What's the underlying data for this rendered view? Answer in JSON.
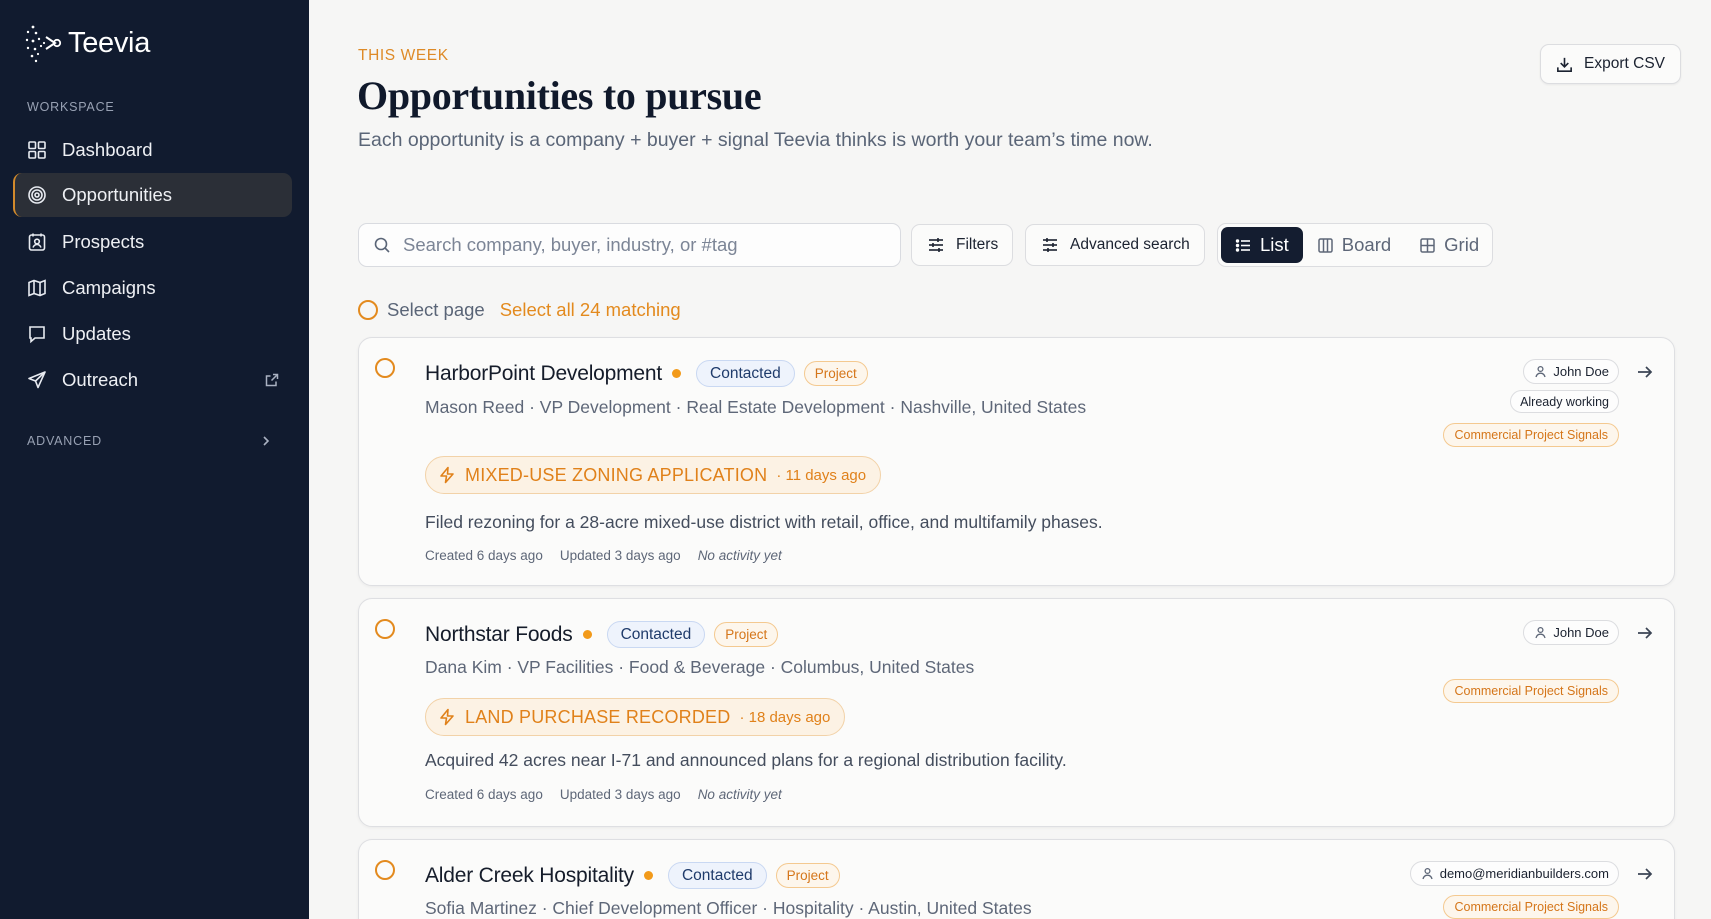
{
  "brand": {
    "name": "Teevia"
  },
  "sidebar": {
    "workspace_label": "WORKSPACE",
    "items": [
      {
        "label": "Dashboard",
        "icon": "dashboard-icon",
        "active": false
      },
      {
        "label": "Opportunities",
        "icon": "target-icon",
        "active": true
      },
      {
        "label": "Prospects",
        "icon": "contact-card-icon",
        "active": false
      },
      {
        "label": "Campaigns",
        "icon": "map-icon",
        "active": false
      },
      {
        "label": "Updates",
        "icon": "message-icon",
        "active": false
      },
      {
        "label": "Outreach",
        "icon": "send-icon",
        "active": false,
        "external": true
      }
    ],
    "advanced_label": "ADVANCED"
  },
  "header": {
    "eyebrow": "THIS WEEK",
    "title": "Opportunities to pursue",
    "subtitle": "Each opportunity is a company + buyer + signal Teevia thinks is worth your team’s time now.",
    "export_label": "Export CSV"
  },
  "toolbar": {
    "search_placeholder": "Search company, buyer, industry, or #tag",
    "filters_label": "Filters",
    "advanced_label": "Advanced search",
    "views": [
      {
        "label": "List",
        "icon": "list-icon",
        "active": true
      },
      {
        "label": "Board",
        "icon": "board-icon",
        "active": false
      },
      {
        "label": "Grid",
        "icon": "grid-icon",
        "active": false
      }
    ]
  },
  "selection": {
    "select_page": "Select page",
    "select_all": "Select all 24 matching"
  },
  "opportunities": [
    {
      "company": "HarborPoint Development",
      "status": "Contacted",
      "type": "Project",
      "meta": "Mason Reed · VP Development · Real Estate Development · Nashville, United States",
      "signal_title": "MIXED-USE ZONING APPLICATION",
      "signal_age": "· 11 days ago",
      "description": "Filed rezoning for a 28-acre mixed-use district with retail, office, and multifamily phases.",
      "created": "Created 6 days ago",
      "updated": "Updated 3 days ago",
      "activity": "No activity yet",
      "owner": "John Doe",
      "working": "Already working",
      "signal_tag": "Commercial Project Signals"
    },
    {
      "company": "Northstar Foods",
      "status": "Contacted",
      "type": "Project",
      "meta": "Dana Kim · VP Facilities · Food & Beverage · Columbus, United States",
      "signal_title": "LAND PURCHASE RECORDED",
      "signal_age": "· 18 days ago",
      "description": "Acquired 42 acres near I-71 and announced plans for a regional distribution facility.",
      "created": "Created 6 days ago",
      "updated": "Updated 3 days ago",
      "activity": "No activity yet",
      "owner": "John Doe",
      "signal_tag": "Commercial Project Signals"
    },
    {
      "company": "Alder Creek Hospitality",
      "status": "Contacted",
      "type": "Project",
      "meta": "Sofia Martinez · Chief Development Officer · Hospitality · Austin, United States",
      "owner": "demo@meridianbuilders.com",
      "signal_tag": "Commercial Project Signals"
    }
  ],
  "colors": {
    "sidebar_bg": "#111b2f",
    "accent": "#e38a1e",
    "status_blue": "#1f3b6b",
    "page_bg": "#f6f6f5"
  }
}
